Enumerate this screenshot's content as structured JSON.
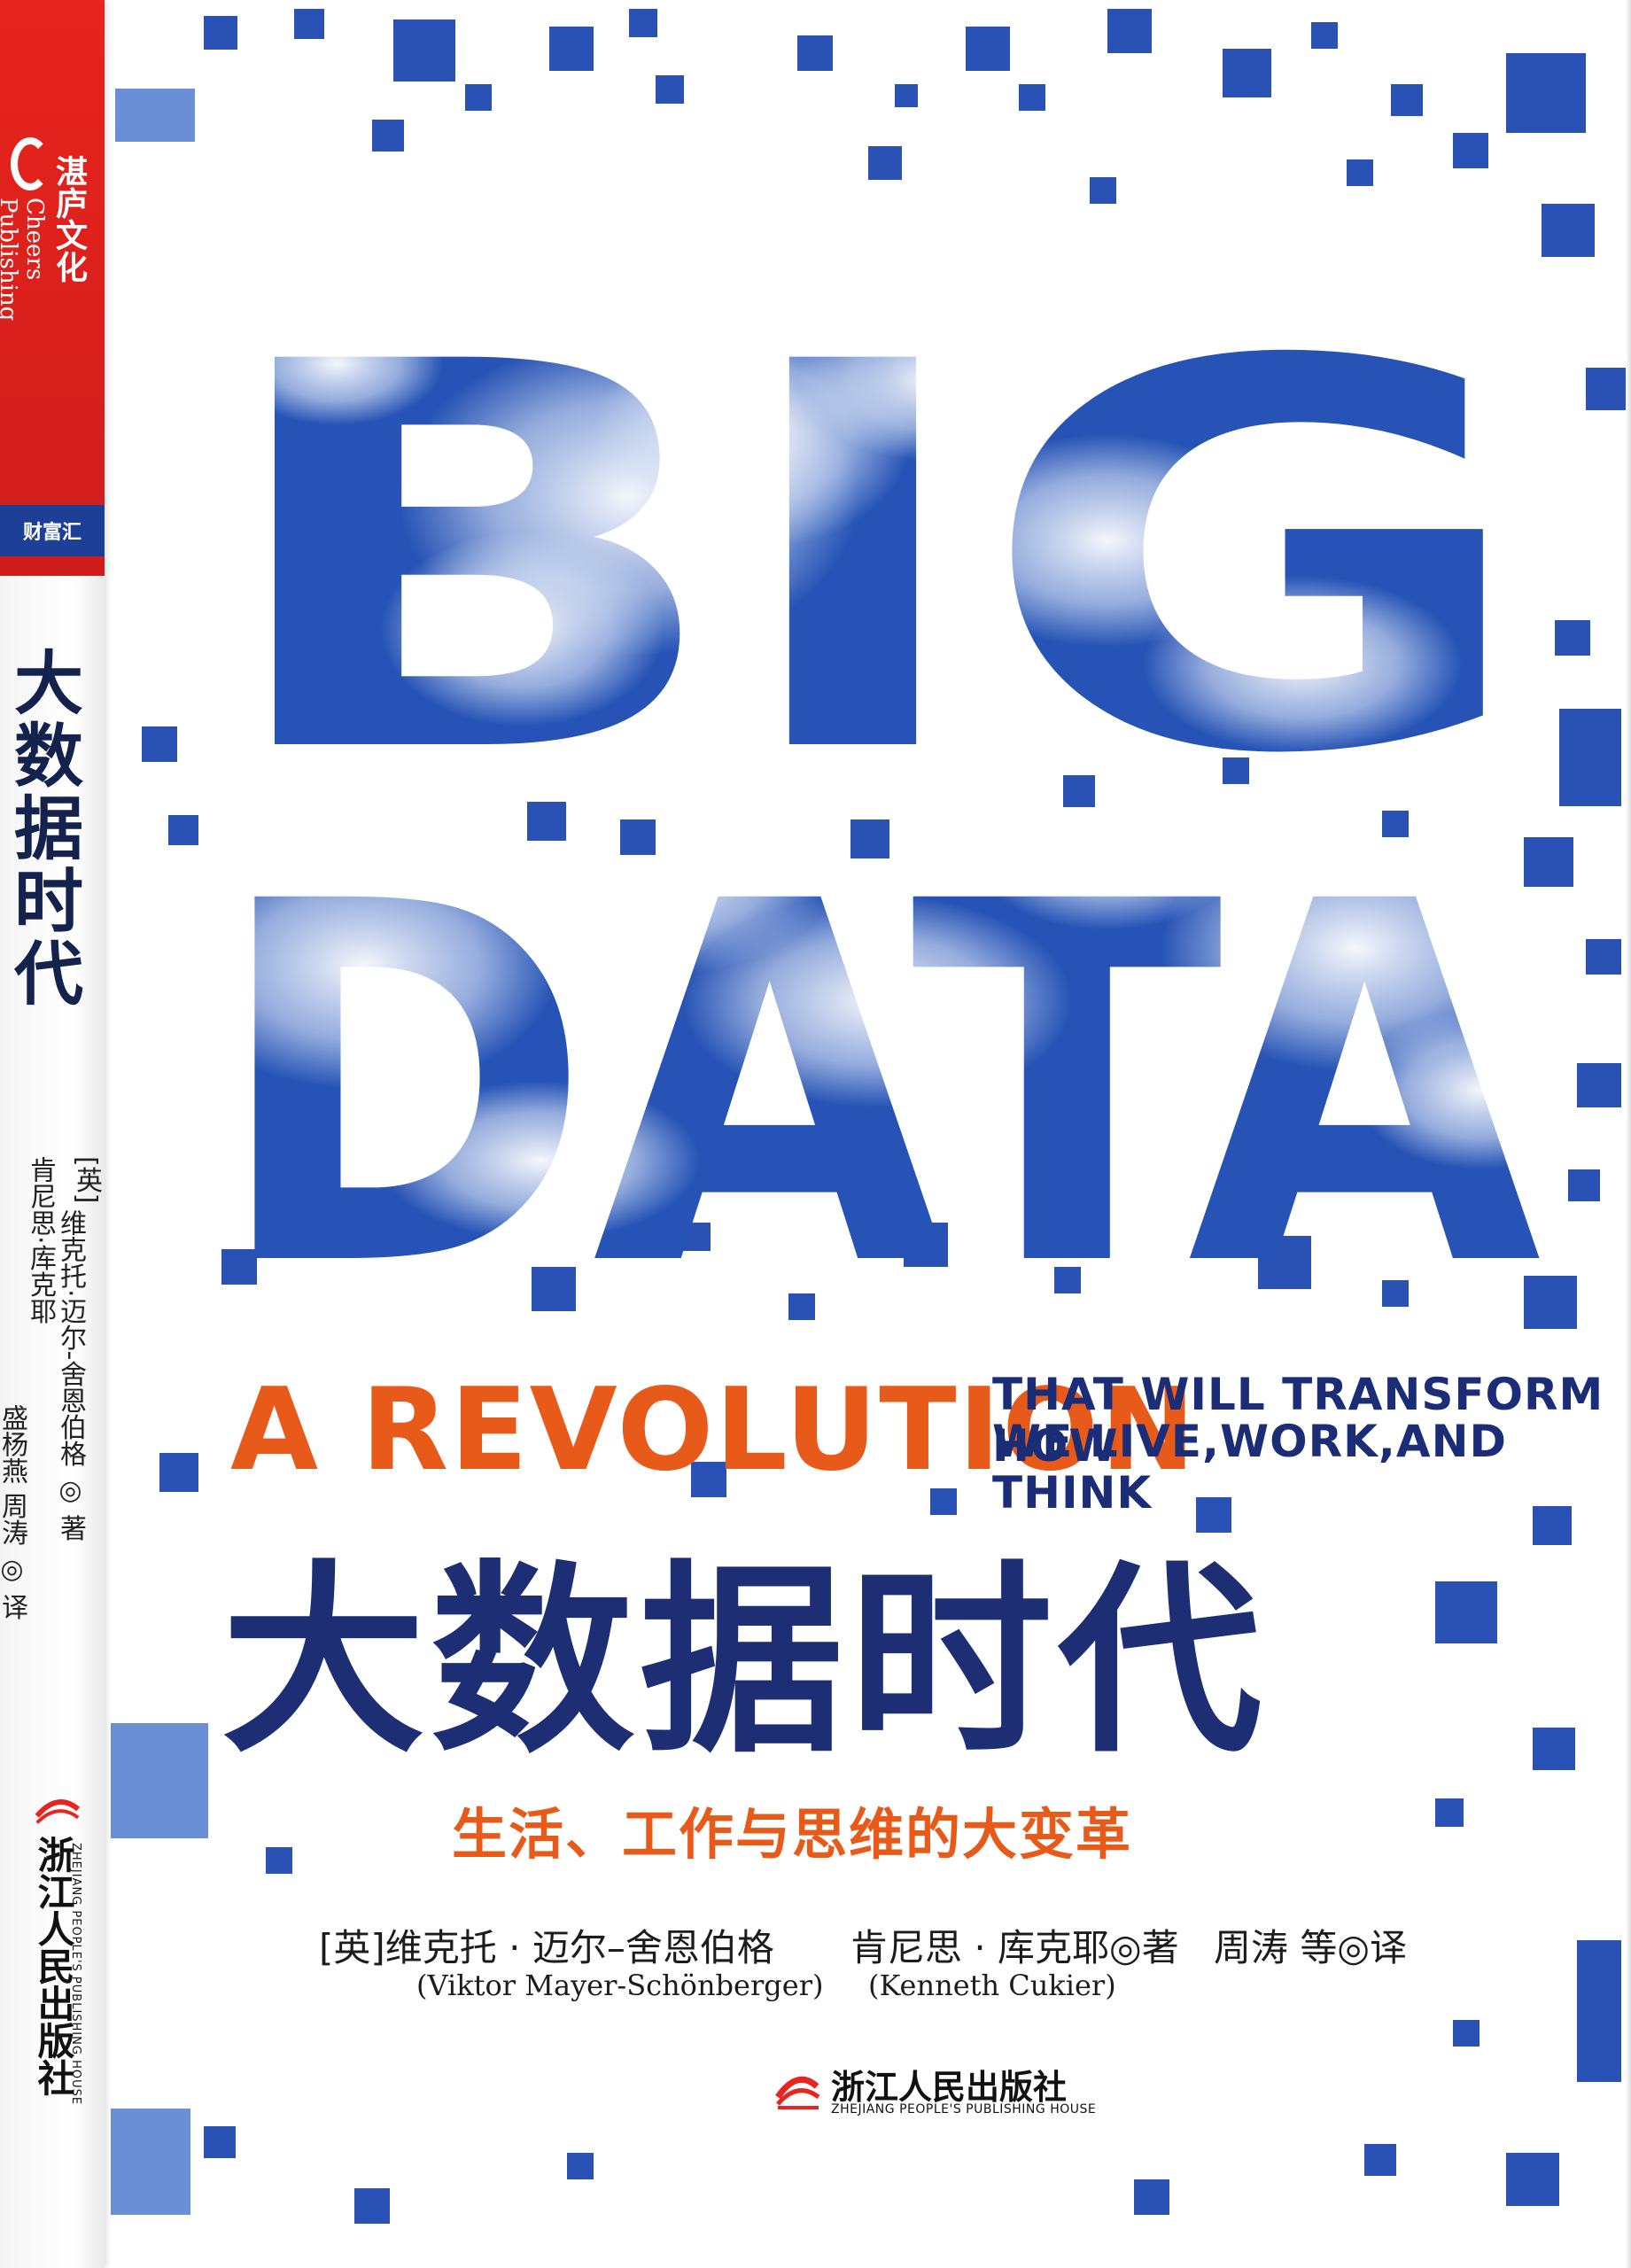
{
  "spine": {
    "logo_cn": "湛庐文化",
    "logo_en": "Cheers Publishing",
    "series": "财富汇",
    "title": "大数据时代",
    "author_col1": "[英]",
    "author_col2": "维克托·迈尔-舍恩伯格 ◎ 著",
    "author_col3": "肯尼思·库克耶",
    "author_col4": "盛杨燕  周涛 ◎ 译",
    "publisher_cn": "浙江人民出版社",
    "publisher_en": "ZHEJIANG PEOPLE'S PUBLISHING HOUSE"
  },
  "cover": {
    "big_word_1": "BIG",
    "big_word_2": "DATA",
    "tagline_main": "A REVOLUTION",
    "tagline_1": "THAT WILL TRANSFORM HOW",
    "tagline_2": "WE LIVE,WORK,AND THINK",
    "title_cn": "大数据时代",
    "subtitle_cn": "生活、工作与思维的大变革",
    "author1_cn": "[英]维克托 · 迈尔–舍恩伯格",
    "author1_en": "(Viktor Mayer-Schönberger)",
    "author2_cn": "肯尼思 · 库克耶◎著",
    "author2_en": "(Kenneth Cukier)",
    "translator": "周涛  等◎译",
    "publisher_cn": "浙江人民出版社",
    "publisher_en": "ZHEJIANG PEOPLE'S PUBLISHING HOUSE"
  },
  "colors": {
    "sky_blue": "#2a52b5",
    "orange": "#e85a1a",
    "navy": "#1d2e74",
    "spine_red": "#e8241e"
  }
}
